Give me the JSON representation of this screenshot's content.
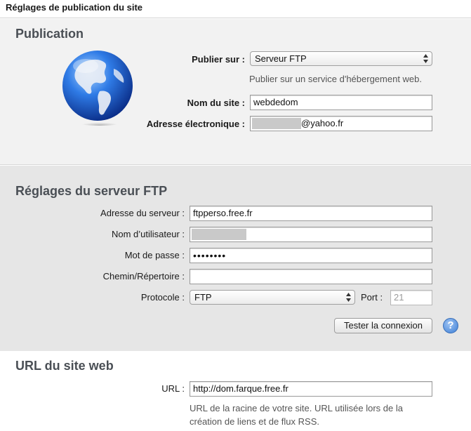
{
  "header": {
    "title": "Réglages de publication du site"
  },
  "publication": {
    "title": "Publication",
    "publish_on_label": "Publier sur :",
    "publish_on_value": "Serveur FTP",
    "publish_hint": "Publier sur un service d'hébergement web.",
    "site_name_label": "Nom du site :",
    "site_name_value": "webdedom",
    "email_label": "Adresse électronique :",
    "email_suffix": "@yahoo.fr"
  },
  "ftp": {
    "title": "Réglages du serveur FTP",
    "server_label": "Adresse du serveur :",
    "server_value": "ftpperso.free.fr",
    "user_label": "Nom d’utilisateur :",
    "password_label": "Mot de passe :",
    "password_mask": "••••••••",
    "path_label": "Chemin/Répertoire :",
    "path_value": "",
    "protocol_label": "Protocole :",
    "protocol_value": "FTP",
    "port_label": "Port :",
    "port_value": "21",
    "test_button": "Tester la connexion",
    "help_glyph": "?"
  },
  "url": {
    "title": "URL du site web",
    "url_label": "URL :",
    "url_value": "http://dom.farque.free.fr",
    "hint_line1": "URL de la racine de votre site. URL utilisée lors de la",
    "hint_line2": "création de liens et de flux RSS."
  },
  "colors": {
    "section_title": "#4a4f55",
    "publication_bg": "#f2f2f2",
    "ftp_bg": "#e6e6e6",
    "help_blue": "#3d7fd6"
  },
  "icons": {
    "globe": "globe-icon",
    "help": "help-icon",
    "select_arrows": "up-down-arrows-icon"
  }
}
